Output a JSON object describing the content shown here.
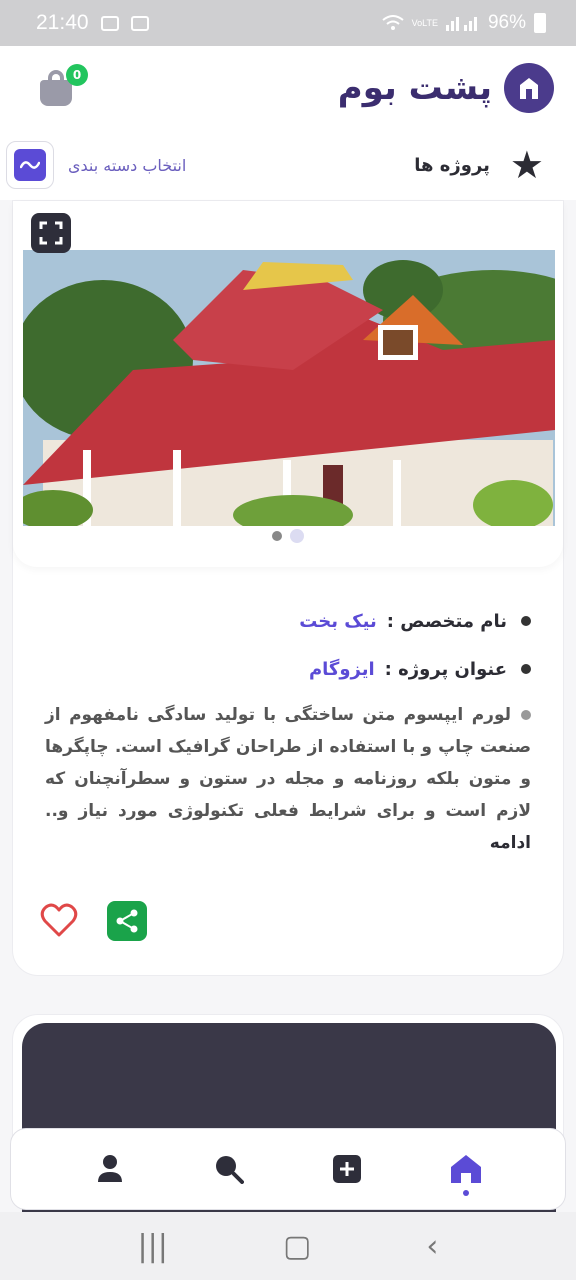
{
  "status_bar": {
    "time": "21:40",
    "network": "VoLTE",
    "battery": "96%"
  },
  "header": {
    "brand_name": "پشت بوم",
    "cart_badge": "0",
    "brand_color": "#4b3b8c"
  },
  "subheader": {
    "category_label": "انتخاب دسته بندی",
    "title": "پروژه ها"
  },
  "project": {
    "expert_label": "نام متخصص :",
    "expert_value": "نیک بخت",
    "title_label": "عنوان پروژه :",
    "title_value": "ایزوگام",
    "description": "لورم ایپسوم متن ساختگی با تولید سادگی نامفهوم از صنعت چاپ و با استفاده از طراحان گرافیک است. چاپگرها و متون بلکه روزنامه و مجله در ستون و سطرآنچنان که لازم است و برای شرایط فعلی تکنولوژی مورد نیاز و..",
    "more_label": "ادامه",
    "slides": 2,
    "active_slide": 1
  },
  "bottom_nav": {
    "items": [
      "profile",
      "search",
      "add",
      "home"
    ],
    "active": "home"
  },
  "colors": {
    "accent": "#5b4bd6",
    "share": "#1aa34a",
    "heart": "#e04848"
  }
}
